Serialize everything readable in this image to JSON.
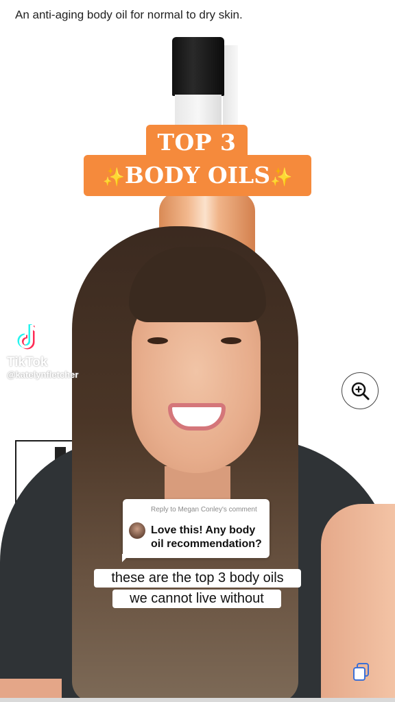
{
  "product": {
    "description": "An anti-aging body oil for normal to dry skin."
  },
  "title": {
    "line1": "TOP 3",
    "sparkle_left": "✨",
    "line2": "BODY OILS",
    "sparkle_right": "✨",
    "color": "#f58a3c"
  },
  "watermark": {
    "brand": "TikTok",
    "handle": "@katelynfletcher"
  },
  "reply": {
    "label": "Reply to Megan Conley's comment",
    "comment": "Love this! Any body oil recommendation?"
  },
  "captions": {
    "line1": "these are the top 3 body oils",
    "line2": "we cannot live without"
  },
  "icons": {
    "zoom": "zoom-in-icon",
    "tiktok": "tiktok-logo-icon",
    "copy": "copy-icon"
  }
}
